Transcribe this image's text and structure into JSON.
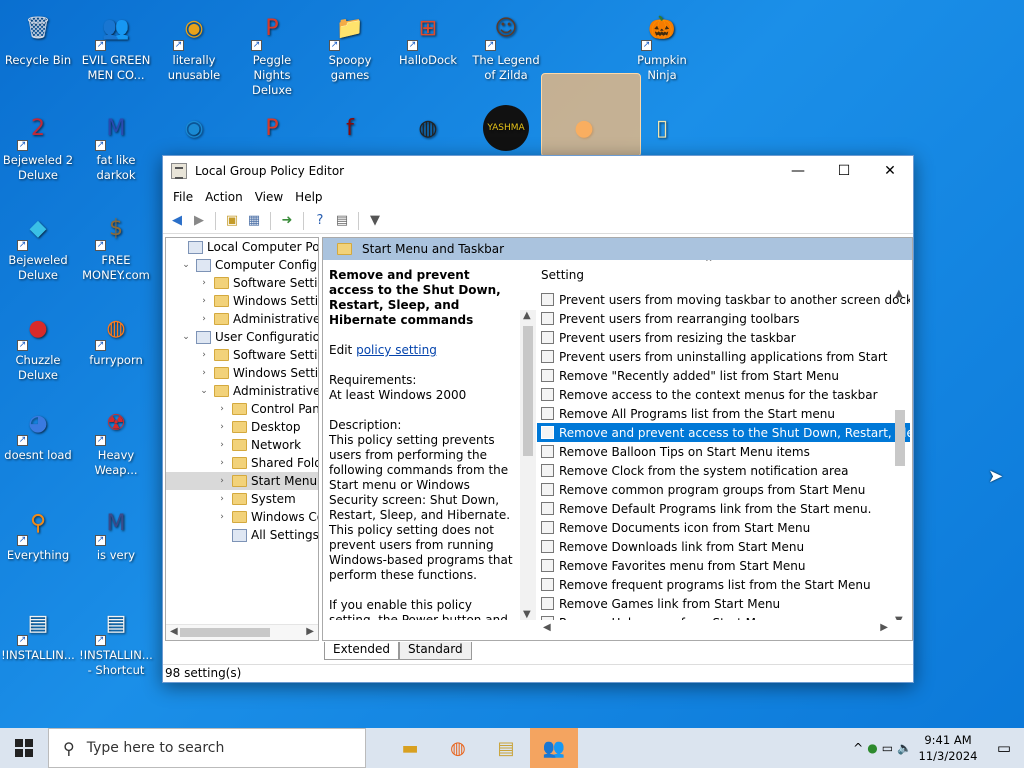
{
  "desktop": {
    "icons": [
      {
        "label": "Recycle Bin",
        "glyph": "🗑"
      },
      {
        "label": "EVIL GREEN MEN CO...",
        "glyph": "👥"
      },
      {
        "label": "literally unusable",
        "glyph": "◉"
      },
      {
        "label": "Peggle Nights Deluxe",
        "glyph": "P"
      },
      {
        "label": "Spoopy games",
        "glyph": "📁"
      },
      {
        "label": "HalloDock",
        "glyph": "⊞"
      },
      {
        "label": "The Legend of Zilda",
        "glyph": "☺"
      },
      {
        "label": "Pumpkin Ninja",
        "glyph": "🎃"
      },
      {
        "label": "Bejeweled 2 Deluxe",
        "glyph": "2"
      },
      {
        "label": "fat like darkok",
        "glyph": "M"
      },
      {
        "label": "Bejeweled Deluxe",
        "glyph": "◆"
      },
      {
        "label": "FREE MONEY.com",
        "glyph": "$"
      },
      {
        "label": "Chuzzle Deluxe",
        "glyph": "●"
      },
      {
        "label": "furryporn",
        "glyph": "◍"
      },
      {
        "label": "doesnt load",
        "glyph": "◕"
      },
      {
        "label": "Heavy Weap...",
        "glyph": "☢"
      },
      {
        "label": "Everything",
        "glyph": "⚲"
      },
      {
        "label": "is very",
        "glyph": "M"
      },
      {
        "label": "!INSTALLIN...",
        "glyph": "▤"
      },
      {
        "label": "!INSTALLIN... - Shortcut",
        "glyph": "▤"
      }
    ],
    "row2_unlabeled": [
      "edge",
      "peggle",
      "flash",
      "obs",
      "yashma",
      "pumpkin",
      "folder"
    ],
    "row2_yashma_text": "YASHMA"
  },
  "window": {
    "title": "Local Group Policy Editor",
    "menu": [
      "File",
      "Action",
      "View",
      "Help"
    ],
    "tree": [
      {
        "label": "Local Computer Policy",
        "depth": 0
      },
      {
        "label": "Computer Configura",
        "depth": 1
      },
      {
        "label": "Software Settings",
        "depth": 2
      },
      {
        "label": "Windows Setting",
        "depth": 2
      },
      {
        "label": "Administrative Te",
        "depth": 2
      },
      {
        "label": "User Configuration",
        "depth": 1
      },
      {
        "label": "Software Settings",
        "depth": 2
      },
      {
        "label": "Windows Setting",
        "depth": 2
      },
      {
        "label": "Administrative Te",
        "depth": 2
      },
      {
        "label": "Control Panel",
        "depth": 3
      },
      {
        "label": "Desktop",
        "depth": 3
      },
      {
        "label": "Network",
        "depth": 3
      },
      {
        "label": "Shared Folder",
        "depth": 3
      },
      {
        "label": "Start Menu ar",
        "depth": 3
      },
      {
        "label": "System",
        "depth": 3
      },
      {
        "label": "Windows Cor",
        "depth": 3
      },
      {
        "label": "All Settings",
        "depth": 3
      }
    ],
    "panel_header": "Start Menu and Taskbar",
    "desc": {
      "title": "Remove and prevent access to the Shut Down, Restart, Sleep, and Hibernate commands",
      "edit_prefix": "Edit",
      "edit_link": "policy setting",
      "req_label": "Requirements:",
      "req_value": "At least Windows 2000",
      "desc_label": "Description:",
      "desc_text": "This policy setting prevents users from performing the following commands from the Start menu or Windows Security screen: Shut Down, Restart, Sleep, and Hibernate. This policy setting does not prevent users from running Windows-based programs that perform these functions.",
      "more_text": "If you enable this policy setting, the Power button and the Shut Down, Restart, Sleep, and Hibernate commands are removed from the Start menu. The"
    },
    "list_header": "Setting",
    "settings": [
      "Prevent users from moving taskbar to another screen dock l...",
      "Prevent users from rearranging toolbars",
      "Prevent users from resizing the taskbar",
      "Prevent users from uninstalling applications from Start",
      "Remove \"Recently added\" list from Start Menu",
      "Remove access to the context menus for the taskbar",
      "Remove All Programs list from the Start menu",
      "Remove and prevent access to the Shut Down, Restart, Sleep...",
      "Remove Balloon Tips on Start Menu items",
      "Remove Clock from the system notification area",
      "Remove common program groups from Start Menu",
      "Remove Default Programs link from the Start menu.",
      "Remove Documents icon from Start Menu",
      "Remove Downloads link from Start Menu",
      "Remove Favorites menu from Start Menu",
      "Remove frequent programs list from the Start Menu",
      "Remove Games link from Start Menu",
      "Remove Help menu from Start Menu"
    ],
    "selected_index": 7,
    "tabs": [
      "Extended",
      "Standard"
    ],
    "status": "98 setting(s)"
  },
  "taskbar": {
    "search_placeholder": "Type here to search",
    "time": "9:41 AM",
    "date": "11/3/2024"
  }
}
